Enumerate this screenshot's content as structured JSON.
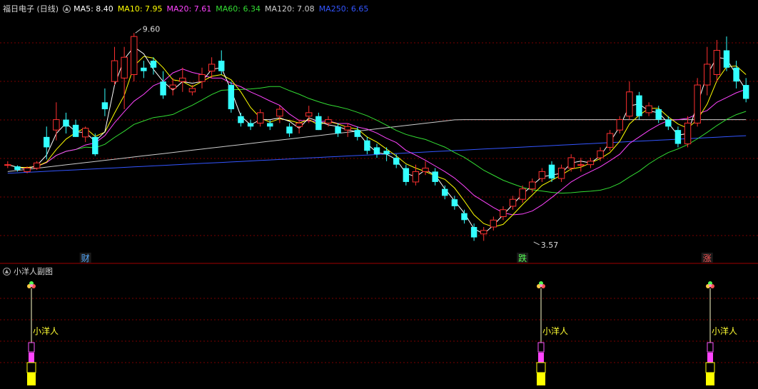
{
  "header": {
    "stock_title": "福日电子 (日线)",
    "ma_labels": [
      {
        "text": "MA5: 8.40",
        "color": "#ffffff"
      },
      {
        "text": "MA10: 7.95",
        "color": "#ffff00"
      },
      {
        "text": "MA20: 7.61",
        "color": "#ff44ff"
      },
      {
        "text": "MA60: 6.34",
        "color": "#33dd33"
      },
      {
        "text": "MA120: 7.08",
        "color": "#cccccc"
      },
      {
        "text": "MA250: 6.65",
        "color": "#3355ff"
      }
    ]
  },
  "sub_panel": {
    "title": "小洋人副图",
    "signal_label": "小洋人",
    "signal_x_index": [
      2,
      56,
      73
    ]
  },
  "markers": [
    {
      "text": "财",
      "x_index": 8,
      "color": "#55aaff"
    },
    {
      "text": "跌",
      "x_index": 53,
      "color": "#55ff55"
    },
    {
      "text": "涨",
      "x_index": 72,
      "color": "#ff5555"
    }
  ],
  "chart_data": {
    "type": "candlestick",
    "annotations": [
      {
        "text": "9.60",
        "x_index": 13,
        "y": 9.6
      },
      {
        "text": "3.57",
        "x_index": 54,
        "y": 3.57
      }
    ],
    "candles": [
      [
        5.8,
        5.9,
        5.7,
        5.8
      ],
      [
        5.75,
        5.78,
        5.6,
        5.65
      ],
      [
        5.6,
        5.75,
        5.55,
        5.7
      ],
      [
        5.7,
        5.9,
        5.65,
        5.85
      ],
      [
        6.6,
        6.9,
        5.95,
        6.3
      ],
      [
        6.8,
        7.6,
        6.5,
        7.1
      ],
      [
        7.1,
        7.3,
        6.7,
        6.9
      ],
      [
        6.95,
        7.1,
        6.6,
        6.6
      ],
      [
        6.6,
        6.9,
        6.45,
        6.85
      ],
      [
        6.6,
        6.7,
        6.05,
        6.1
      ],
      [
        7.6,
        8.0,
        7.2,
        7.4
      ],
      [
        8.2,
        9.2,
        8.1,
        8.8
      ],
      [
        8.3,
        9.2,
        7.4,
        8.9
      ],
      [
        8.4,
        9.6,
        8.2,
        9.5
      ],
      [
        8.6,
        8.8,
        8.3,
        8.5
      ],
      [
        8.8,
        8.9,
        8.4,
        8.6
      ],
      [
        8.2,
        8.5,
        7.7,
        7.8
      ],
      [
        8.0,
        8.3,
        7.8,
        8.1
      ],
      [
        8.2,
        8.6,
        7.9,
        8.3
      ],
      [
        7.9,
        8.1,
        7.8,
        8.0
      ],
      [
        8.2,
        8.6,
        8.0,
        8.4
      ],
      [
        8.5,
        8.9,
        8.3,
        8.7
      ],
      [
        8.8,
        9.1,
        8.4,
        8.5
      ],
      [
        8.1,
        8.2,
        7.3,
        7.4
      ],
      [
        7.2,
        7.3,
        6.9,
        7.0
      ],
      [
        7.0,
        7.1,
        6.8,
        6.9
      ],
      [
        7.0,
        7.4,
        6.9,
        7.3
      ],
      [
        7.0,
        7.1,
        6.8,
        6.9
      ],
      [
        7.2,
        7.5,
        7.0,
        7.4
      ],
      [
        6.9,
        7.0,
        6.6,
        6.7
      ],
      [
        6.9,
        7.1,
        6.7,
        7.0
      ],
      [
        7.2,
        7.5,
        7.0,
        7.3
      ],
      [
        7.2,
        7.3,
        6.8,
        6.8
      ],
      [
        7.0,
        7.2,
        6.9,
        7.1
      ],
      [
        6.9,
        7.0,
        6.6,
        6.7
      ],
      [
        6.8,
        7.0,
        6.6,
        6.9
      ],
      [
        6.8,
        6.9,
        6.5,
        6.6
      ],
      [
        6.5,
        6.6,
        6.1,
        6.2
      ],
      [
        6.3,
        6.4,
        6.0,
        6.1
      ],
      [
        6.2,
        6.3,
        5.9,
        6.1
      ],
      [
        6.0,
        6.1,
        5.7,
        5.8
      ],
      [
        5.7,
        5.8,
        5.2,
        5.3
      ],
      [
        5.3,
        5.8,
        5.2,
        5.6
      ],
      [
        5.6,
        5.9,
        5.5,
        5.7
      ],
      [
        5.6,
        5.7,
        5.2,
        5.3
      ],
      [
        5.1,
        5.2,
        4.8,
        4.9
      ],
      [
        4.8,
        4.9,
        4.5,
        4.6
      ],
      [
        4.4,
        4.5,
        4.1,
        4.2
      ],
      [
        4.0,
        4.1,
        3.6,
        3.7
      ],
      [
        3.8,
        4.0,
        3.6,
        3.9
      ],
      [
        4.0,
        4.3,
        3.9,
        4.2
      ],
      [
        4.3,
        4.6,
        4.2,
        4.5
      ],
      [
        4.6,
        4.9,
        4.5,
        4.8
      ],
      [
        4.8,
        5.2,
        4.7,
        5.1
      ],
      [
        5.1,
        5.4,
        5.0,
        5.3
      ],
      [
        5.4,
        5.7,
        5.3,
        5.6
      ],
      [
        5.8,
        5.9,
        5.3,
        5.4
      ],
      [
        5.4,
        5.8,
        5.3,
        5.7
      ],
      [
        5.7,
        6.1,
        5.6,
        6.0
      ],
      [
        5.8,
        6.0,
        5.6,
        5.8
      ],
      [
        5.8,
        6.0,
        5.7,
        5.9
      ],
      [
        6.0,
        6.3,
        5.9,
        6.2
      ],
      [
        6.3,
        6.8,
        6.2,
        6.7
      ],
      [
        6.8,
        7.2,
        6.7,
        7.1
      ],
      [
        7.2,
        8.2,
        7.1,
        7.9
      ],
      [
        7.8,
        7.9,
        7.1,
        7.2
      ],
      [
        7.3,
        7.6,
        7.2,
        7.5
      ],
      [
        7.4,
        7.5,
        7.0,
        7.1
      ],
      [
        7.1,
        7.2,
        6.8,
        6.9
      ],
      [
        6.8,
        6.9,
        6.3,
        6.4
      ],
      [
        6.4,
        7.2,
        6.3,
        7.0
      ],
      [
        7.0,
        8.3,
        6.9,
        8.1
      ],
      [
        8.1,
        9.2,
        7.8,
        8.7
      ],
      [
        8.4,
        9.4,
        8.2,
        9.1
      ],
      [
        9.1,
        9.5,
        8.5,
        8.6
      ],
      [
        8.6,
        8.8,
        8.0,
        8.2
      ],
      [
        8.1,
        8.3,
        7.6,
        7.7
      ]
    ],
    "ylim": [
      3.3,
      10.1
    ],
    "series_colors": {
      "ma5": "#ffffff",
      "ma10": "#ffff00",
      "ma20": "#ff44ff",
      "ma60": "#33dd33",
      "ma120": "#cccccc",
      "ma250": "#3355ff",
      "up": "#ff3030",
      "down": "#33ffff"
    }
  }
}
